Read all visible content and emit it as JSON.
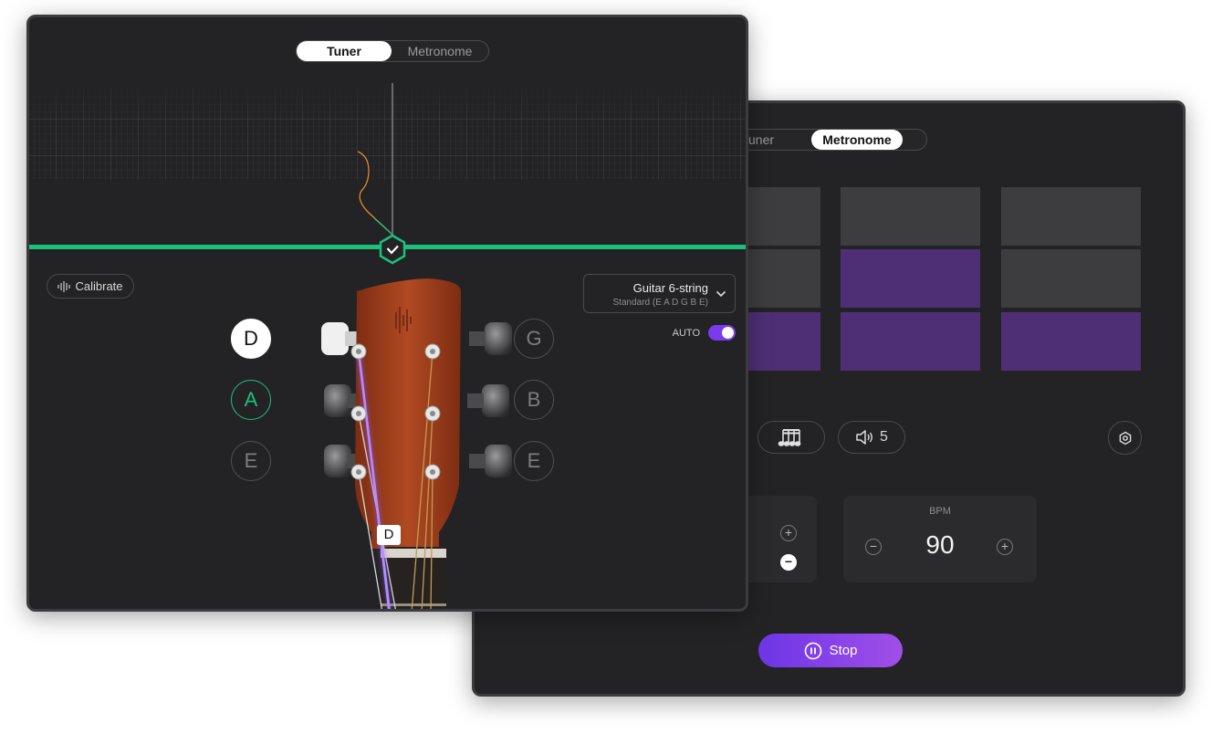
{
  "tuner": {
    "tabs": [
      {
        "label": "Tuner",
        "active": true
      },
      {
        "label": "Metronome",
        "active": false
      }
    ],
    "calibrate_label": "Calibrate",
    "instrument": {
      "name": "Guitar 6-string",
      "tuning": "Standard (E A D G B E)"
    },
    "auto_label": "AUTO",
    "auto_enabled": true,
    "left_notes": [
      {
        "label": "D",
        "state": "selected"
      },
      {
        "label": "A",
        "state": "active"
      },
      {
        "label": "E",
        "state": "idle"
      }
    ],
    "right_notes": [
      {
        "label": "G",
        "state": "idle"
      },
      {
        "label": "B",
        "state": "idle"
      },
      {
        "label": "E",
        "state": "idle"
      }
    ],
    "nut_marker": "D",
    "colors": {
      "in_tune": "#1bc07c",
      "string_active": "#8b5cf6",
      "headstock": "#a8401f",
      "pitch_trace": "#e58a2a"
    }
  },
  "metronome": {
    "tabs": [
      {
        "label": "Tuner",
        "active": false
      },
      {
        "label": "Metronome",
        "active": true
      }
    ],
    "pads": [
      [
        "off",
        "off",
        "off"
      ],
      [
        "off",
        "on",
        "off"
      ],
      [
        "on",
        "on",
        "on"
      ]
    ],
    "volume_value": "5",
    "bpm_label": "BPM",
    "bpm_value": "90",
    "stop_label": "Stop",
    "colors": {
      "accent": "#7c3aed",
      "pad_on": "#4e2f76",
      "pad_off": "#3d3d3f"
    }
  }
}
